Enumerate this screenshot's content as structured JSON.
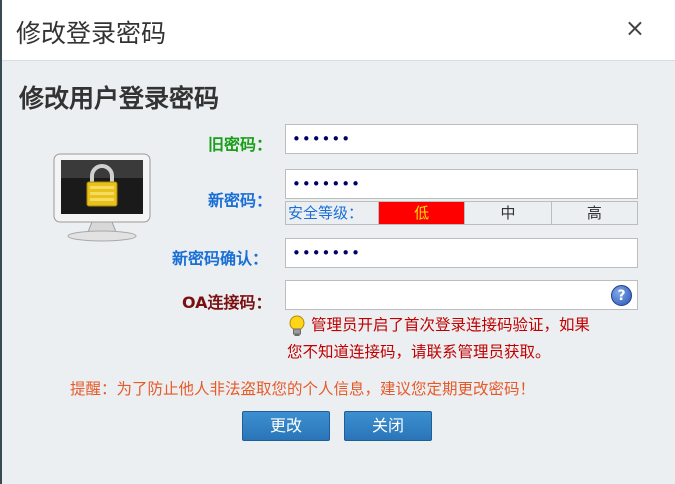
{
  "dialog": {
    "title": "修改登录密码",
    "close_icon": "×",
    "heading": "修改用户登录密码"
  },
  "form": {
    "old_password": {
      "label": "旧密码：",
      "value": "••••••"
    },
    "new_password": {
      "label": "新密码：",
      "value": "•••••••"
    },
    "strength": {
      "caption": "安全等级：",
      "levels": [
        "低",
        "中",
        "高"
      ],
      "active": "低"
    },
    "confirm_password": {
      "label": "新密码确认：",
      "value": "•••••••"
    },
    "oa_code": {
      "label": "OA连接码：",
      "value": ""
    }
  },
  "tip": {
    "line1": "管理员开启了首次登录连接码验证，如果",
    "line2": "您不知道连接码，请联系管理员获取。"
  },
  "warning": "提醒：为了防止他人非法盗取您的个人信息，建议您定期更改密码！",
  "buttons": {
    "change": "更改",
    "close": "关闭"
  },
  "icons": {
    "help": "?",
    "monitor": "lock-monitor-icon",
    "bulb": "lightbulb-icon"
  },
  "colors": {
    "accent": "#2a75b8",
    "weak": "#ff0000"
  }
}
